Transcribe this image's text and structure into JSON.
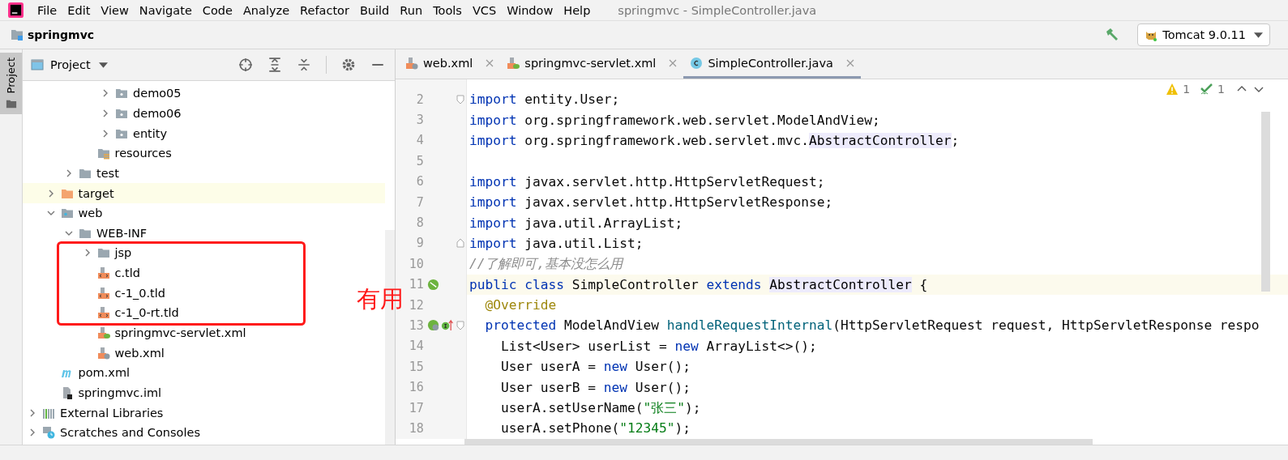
{
  "window": {
    "title": "springmvc - SimpleController.java"
  },
  "menu": [
    "File",
    "Edit",
    "View",
    "Navigate",
    "Code",
    "Analyze",
    "Refactor",
    "Build",
    "Run",
    "Tools",
    "VCS",
    "Window",
    "Help"
  ],
  "nav": {
    "project": "springmvc",
    "run_config": "Tomcat 9.0.11"
  },
  "side_strip": {
    "tabs": [
      {
        "label": "Project",
        "selected": true
      }
    ]
  },
  "project_panel": {
    "title": "Project",
    "tree": [
      {
        "children": [
          {
            "children": [
              {
                "children": [
                  {
                    "children": [
                      {
                        "label": "demo05",
                        "kind": "package",
                        "expanded": false
                      },
                      {
                        "label": "demo06",
                        "kind": "package",
                        "expanded": false
                      },
                      {
                        "label": "entity",
                        "kind": "package",
                        "expanded": false
                      }
                    ]
                  },
                  {
                    "label": "resources",
                    "kind": "resources"
                  }
                ]
              },
              {
                "label": "test",
                "kind": "folder",
                "expanded": false
              }
            ]
          },
          {
            "label": "target",
            "kind": "excluded",
            "expanded": false
          },
          {
            "label": "web",
            "kind": "webfolder",
            "expanded": true,
            "children": [
              {
                "label": "WEB-INF",
                "kind": "folder",
                "expanded": true,
                "children": [
                  {
                    "label": "jsp",
                    "kind": "folder",
                    "expanded": false
                  },
                  {
                    "label": "c.tld",
                    "kind": "tld"
                  },
                  {
                    "label": "c-1_0.tld",
                    "kind": "tld"
                  },
                  {
                    "label": "c-1_0-rt.tld",
                    "kind": "tld"
                  },
                  {
                    "label": "springmvc-servlet.xml",
                    "kind": "spring-xml"
                  },
                  {
                    "label": "web.xml",
                    "kind": "web-xml"
                  }
                ]
              }
            ]
          },
          {
            "label": "pom.xml",
            "kind": "maven"
          },
          {
            "label": "springmvc.iml",
            "kind": "iml"
          }
        ]
      },
      {
        "label": "External Libraries",
        "kind": "libraries",
        "expanded": false
      },
      {
        "label": "Scratches and Consoles",
        "kind": "scratches",
        "expanded": false
      }
    ]
  },
  "editor": {
    "tabs": [
      {
        "label": "web.xml",
        "kind": "web-xml",
        "selected": false
      },
      {
        "label": "springmvc-servlet.xml",
        "kind": "spring-xml",
        "selected": false
      },
      {
        "label": "SimpleController.java",
        "kind": "class",
        "selected": true
      }
    ],
    "inspections": {
      "warnings": "1",
      "passed": "1"
    },
    "lines": [
      {
        "number": "2",
        "kind": "fold-start",
        "tokens": [
          {
            "kind": "keyword",
            "text": "import"
          },
          {
            "kind": "plain",
            "text": " entity.User;"
          }
        ]
      },
      {
        "number": "3",
        "tokens": [
          {
            "kind": "keyword",
            "text": "import"
          },
          {
            "kind": "plain",
            "text": " org.springframework.web.servlet.ModelAndView;"
          }
        ]
      },
      {
        "number": "4",
        "tokens": [
          {
            "kind": "keyword",
            "text": "import"
          },
          {
            "kind": "plain",
            "text": " org.springframework.web.servlet.mvc."
          },
          {
            "kind": "highlight",
            "text": "AbstractController"
          },
          {
            "kind": "plain",
            "text": ";"
          }
        ]
      },
      {
        "number": "5"
      },
      {
        "number": "6",
        "tokens": [
          {
            "kind": "keyword",
            "text": "import"
          },
          {
            "kind": "plain",
            "text": " javax.servlet.http.HttpServletRequest;"
          }
        ]
      },
      {
        "number": "7",
        "tokens": [
          {
            "kind": "keyword",
            "text": "import"
          },
          {
            "kind": "plain",
            "text": " javax.servlet.http.HttpServletResponse;"
          }
        ]
      },
      {
        "number": "8",
        "tokens": [
          {
            "kind": "keyword",
            "text": "import"
          },
          {
            "kind": "plain",
            "text": " java.util.ArrayList;"
          }
        ]
      },
      {
        "number": "9",
        "kind": "fold-end",
        "tokens": [
          {
            "kind": "keyword",
            "text": "import"
          },
          {
            "kind": "plain",
            "text": " java.util.List;"
          }
        ]
      },
      {
        "number": "10",
        "tokens": [
          {
            "kind": "comment",
            "text": "//了解即可,基本没怎么用"
          }
        ]
      },
      {
        "number": "11",
        "kind": "bean-class",
        "current": true,
        "tokens": [
          {
            "kind": "keyword",
            "text": "public class"
          },
          {
            "kind": "plain",
            "text": " SimpleController "
          },
          {
            "kind": "keyword",
            "text": "extends "
          },
          {
            "kind": "highlight",
            "text": "AbstractController"
          },
          {
            "kind": "plain",
            "text": " {"
          }
        ]
      },
      {
        "number": "12",
        "tokens": [
          {
            "kind": "annotation",
            "text": "  @Override"
          }
        ]
      },
      {
        "number": "13",
        "kind": "bean-method",
        "tokens": [
          {
            "kind": "keyword",
            "text": "  protected"
          },
          {
            "kind": "plain",
            "text": " ModelAndView "
          },
          {
            "kind": "method",
            "text": "handleRequestInternal"
          },
          {
            "kind": "plain",
            "text": "(HttpServletRequest request, HttpServletResponse respo"
          }
        ]
      },
      {
        "number": "14",
        "tokens": [
          {
            "kind": "plain",
            "text": "    List<User> userList = "
          },
          {
            "kind": "keyword",
            "text": "new"
          },
          {
            "kind": "plain",
            "text": " ArrayList<>();"
          }
        ]
      },
      {
        "number": "15",
        "tokens": [
          {
            "kind": "plain",
            "text": "    User userA = "
          },
          {
            "kind": "keyword",
            "text": "new"
          },
          {
            "kind": "plain",
            "text": " User();"
          }
        ]
      },
      {
        "number": "16",
        "tokens": [
          {
            "kind": "plain",
            "text": "    User userB = "
          },
          {
            "kind": "keyword",
            "text": "new"
          },
          {
            "kind": "plain",
            "text": " User();"
          }
        ]
      },
      {
        "number": "17",
        "tokens": [
          {
            "kind": "plain",
            "text": "    userA.setUserName("
          },
          {
            "kind": "string",
            "text": "\"张三\""
          },
          {
            "kind": "plain",
            "text": ");"
          }
        ]
      },
      {
        "number": "18",
        "tokens": [
          {
            "kind": "plain",
            "text": "    userA.setPhone("
          },
          {
            "kind": "string",
            "text": "\"12345\""
          },
          {
            "kind": "plain",
            "text": ");"
          }
        ]
      }
    ]
  },
  "annotation": {
    "text": "有用"
  }
}
